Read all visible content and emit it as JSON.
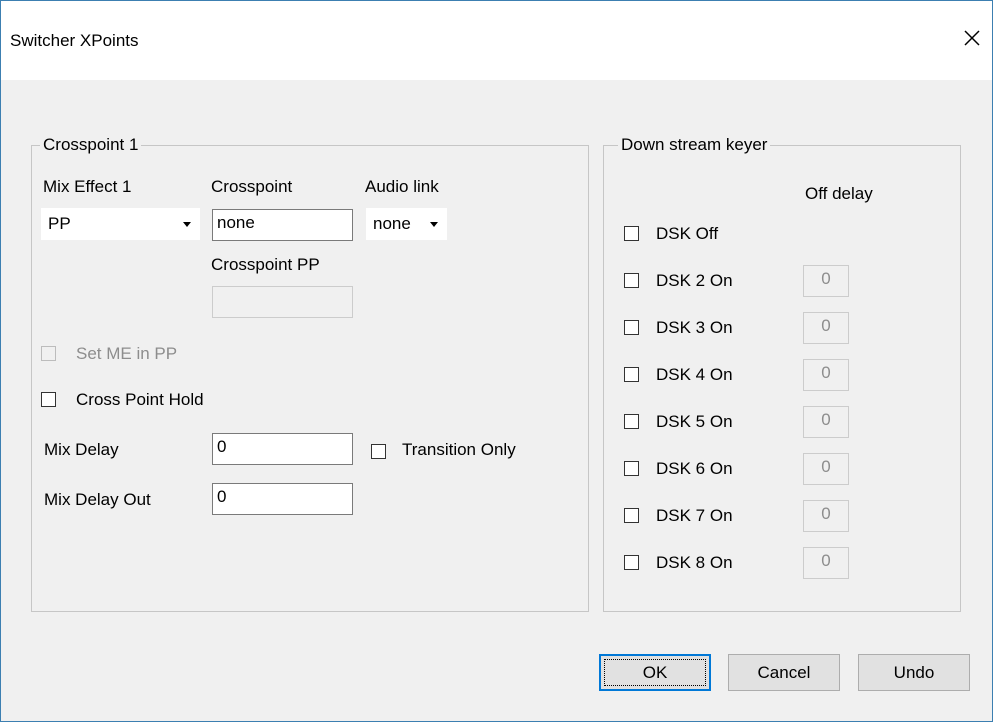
{
  "window": {
    "title": "Switcher XPoints"
  },
  "crosspoint_group": {
    "legend": "Crosspoint 1",
    "mix_effect_label": "Mix Effect 1",
    "mix_effect_value": "PP",
    "crosspoint_label": "Crosspoint",
    "crosspoint_value": "none",
    "audio_link_label": "Audio link",
    "audio_link_value": "none",
    "crosspoint_pp_label": "Crosspoint PP",
    "crosspoint_pp_value": "",
    "set_me_in_pp_label": "Set ME in PP",
    "cross_point_hold_label": "Cross Point Hold",
    "mix_delay_label": "Mix Delay",
    "mix_delay_value": "0",
    "transition_only_label": "Transition Only",
    "mix_delay_out_label": "Mix Delay Out",
    "mix_delay_out_value": "0"
  },
  "dsk_group": {
    "legend": "Down stream keyer",
    "off_delay_header": "Off delay",
    "dsk_off_label": "DSK Off",
    "items": [
      {
        "label": "DSK 2 On",
        "delay": "0"
      },
      {
        "label": "DSK 3 On",
        "delay": "0"
      },
      {
        "label": "DSK 4 On",
        "delay": "0"
      },
      {
        "label": "DSK 5 On",
        "delay": "0"
      },
      {
        "label": "DSK 6 On",
        "delay": "0"
      },
      {
        "label": "DSK 7 On",
        "delay": "0"
      },
      {
        "label": "DSK 8 On",
        "delay": "0"
      }
    ]
  },
  "buttons": {
    "ok": "OK",
    "cancel": "Cancel",
    "undo": "Undo"
  }
}
